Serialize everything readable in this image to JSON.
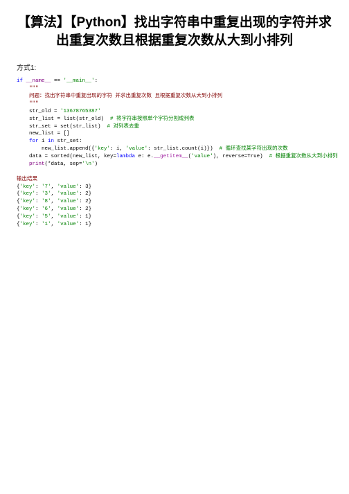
{
  "title": "【算法】【Python】找出字符串中重复出现的字符并求出重复次数且根据重复次数从大到小排列",
  "method_label": "方式1:",
  "code": {
    "l1a": "if",
    "l1b": " __name__ ",
    "l1c": "==",
    "l1d": " '__main__'",
    "l1e": ":",
    "l2a": "    \"\"\"",
    "l2b": "    问题：找出字符串中重复出现的字符 并求出重复次数 且根据重复次数从大到小排列",
    "l2c": "    \"\"\"",
    "l3a": "    str_old = ",
    "l3b": "'13678765387'",
    "l4a": "    str_list = list(str_old)  ",
    "l4b": "# 将字符串按照单个字符分割成列表",
    "l5a": "    str_set = set(str_list)  ",
    "l5b": "# 对列表去重",
    "l6": "    new_list = []",
    "l7a": "    for",
    "l7b": " i ",
    "l7c": "in",
    "l7d": " str_set:",
    "l8a": "        new_list.append({",
    "l8b": "'key'",
    "l8c": ": i, ",
    "l8d": "'value'",
    "l8e": ": str_list.count(i)})  ",
    "l8f": "# 循环查找某字符出现的次数",
    "l9a": "    data = sorted(new_list, key=",
    "l9b": "lambda",
    "l9c": " e: e.",
    "l9d": "__getitem__",
    "l9e": "(",
    "l9f": "'value'",
    "l9g": "), reverse=True)  ",
    "l9h": "# 根据重复次数从大到小排列",
    "l10a": "    print",
    "l10b": "(*data, sep=",
    "l10c": "'\\n'",
    "l10d": ")"
  },
  "output": {
    "header": "输出结果",
    "rows": [
      {
        "k": "'key'",
        "kv": " '7'",
        "v": "'value'",
        "vv": " 3"
      },
      {
        "k": "'key'",
        "kv": " '3'",
        "v": "'value'",
        "vv": " 2"
      },
      {
        "k": "'key'",
        "kv": " '8'",
        "v": "'value'",
        "vv": " 2"
      },
      {
        "k": "'key'",
        "kv": " '6'",
        "v": "'value'",
        "vv": " 2"
      },
      {
        "k": "'key'",
        "kv": " '5'",
        "v": "'value'",
        "vv": " 1"
      },
      {
        "k": "'key'",
        "kv": " '1'",
        "v": "'value'",
        "vv": " 1"
      }
    ]
  }
}
